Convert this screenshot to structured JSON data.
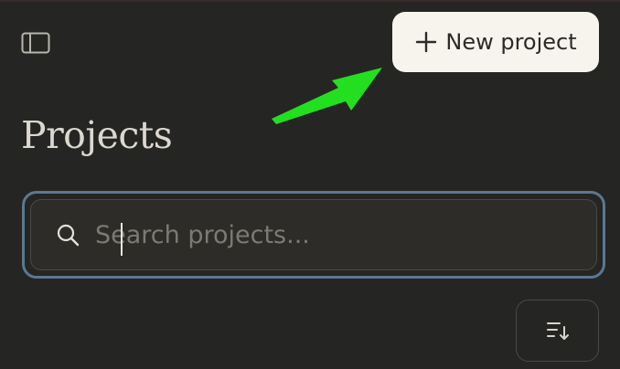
{
  "header": {
    "sidebar_toggle_icon": "sidebar-panel-icon",
    "new_project_label": "New project",
    "new_project_icon": "plus-icon"
  },
  "main": {
    "title": "Projects",
    "search": {
      "placeholder": "Search projects...",
      "value": "",
      "icon": "search-icon"
    },
    "sort_button_icon": "sort-icon"
  },
  "colors": {
    "background": "#252523",
    "button_bg": "#f7f4ed",
    "focus_ring": "#5a7892",
    "annotation_arrow": "#22e01f"
  }
}
